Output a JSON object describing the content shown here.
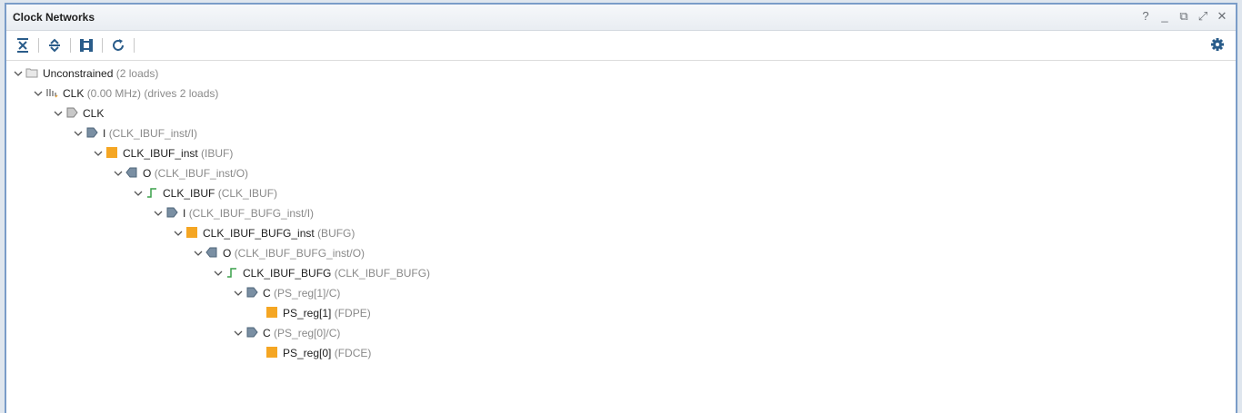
{
  "panel": {
    "title": "Clock Networks",
    "window_buttons": [
      "?",
      "_",
      "⧉",
      "⤢",
      "✕"
    ]
  },
  "toolbar": {
    "buttons": [
      "collapse-all",
      "expand-all",
      "schematic",
      "refresh"
    ],
    "settings_icon": "gear-icon"
  },
  "colors": {
    "cell": "#f5a623",
    "pin": "#7a8fa3",
    "net": "#3aa04a",
    "border": "#7a9cc8"
  },
  "tree": [
    {
      "label": "Unconstrained",
      "detail": "(2 loads)",
      "icon": "folder-icon",
      "depth": 0
    },
    {
      "label": "CLK",
      "detail": "(0.00 MHz) (drives 2 loads)",
      "icon": "clock-icon",
      "depth": 1
    },
    {
      "label": "CLK",
      "detail": "",
      "icon": "port-icon",
      "depth": 2
    },
    {
      "label": "I",
      "detail": "(CLK_IBUF_inst/I)",
      "icon": "input-pin-icon",
      "depth": 3
    },
    {
      "label": "CLK_IBUF_inst",
      "detail": "(IBUF)",
      "icon": "cell-icon",
      "depth": 4
    },
    {
      "label": "O",
      "detail": "(CLK_IBUF_inst/O)",
      "icon": "output-pin-icon",
      "depth": 5
    },
    {
      "label": "CLK_IBUF",
      "detail": "(CLK_IBUF)",
      "icon": "net-icon",
      "depth": 6
    },
    {
      "label": "I",
      "detail": "(CLK_IBUF_BUFG_inst/I)",
      "icon": "input-pin-icon",
      "depth": 7
    },
    {
      "label": "CLK_IBUF_BUFG_inst",
      "detail": "(BUFG)",
      "icon": "cell-icon",
      "depth": 8
    },
    {
      "label": "O",
      "detail": "(CLK_IBUF_BUFG_inst/O)",
      "icon": "output-pin-icon",
      "depth": 9
    },
    {
      "label": "CLK_IBUF_BUFG",
      "detail": "(CLK_IBUF_BUFG)",
      "icon": "net-icon",
      "depth": 10
    },
    {
      "label": "C",
      "detail": "(PS_reg[1]/C)",
      "icon": "input-pin-icon",
      "depth": 11
    },
    {
      "label": "PS_reg[1]",
      "detail": "(FDPE)",
      "icon": "cell-icon",
      "depth": 12,
      "leaf": true
    },
    {
      "label": "C",
      "detail": "(PS_reg[0]/C)",
      "icon": "input-pin-icon",
      "depth": 11
    },
    {
      "label": "PS_reg[0]",
      "detail": "(FDCE)",
      "icon": "cell-icon",
      "depth": 12,
      "leaf": true
    }
  ]
}
